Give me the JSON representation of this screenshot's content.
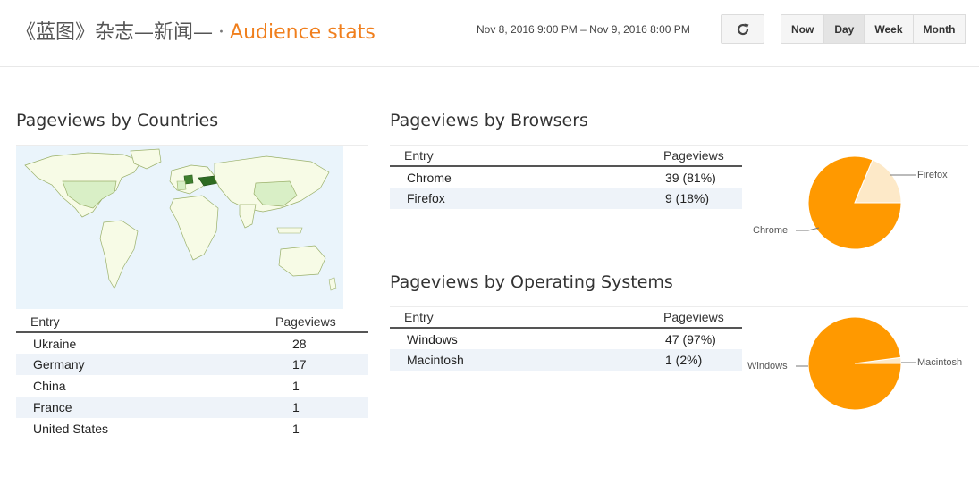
{
  "header": {
    "site_title": "《蓝图》杂志—新闻—",
    "separator": "·",
    "section_title": "Audience stats",
    "date_range": "Nov 8, 2016 9:00 PM – Nov 9, 2016 8:00 PM",
    "refresh_icon": "refresh-icon",
    "period_buttons": [
      {
        "label": "Now",
        "active": false
      },
      {
        "label": "Day",
        "active": true
      },
      {
        "label": "Week",
        "active": false
      },
      {
        "label": "Month",
        "active": false
      }
    ]
  },
  "countries": {
    "title": "Pageviews by Countries",
    "columns": [
      "Entry",
      "Pageviews"
    ],
    "rows": [
      {
        "entry": "Ukraine",
        "value": "28"
      },
      {
        "entry": "Germany",
        "value": "17"
      },
      {
        "entry": "China",
        "value": "1"
      },
      {
        "entry": "France",
        "value": "1"
      },
      {
        "entry": "United States",
        "value": "1"
      }
    ]
  },
  "browsers": {
    "title": "Pageviews by Browsers",
    "columns": [
      "Entry",
      "Pageviews"
    ],
    "rows": [
      {
        "entry": "Chrome",
        "value": "39 (81%)"
      },
      {
        "entry": "Firefox",
        "value": "9 (18%)"
      }
    ]
  },
  "os": {
    "title": "Pageviews by Operating Systems",
    "columns": [
      "Entry",
      "Pageviews"
    ],
    "rows": [
      {
        "entry": "Windows",
        "value": "47 (97%)"
      },
      {
        "entry": "Macintosh",
        "value": "1 (2%)"
      }
    ]
  },
  "colors": {
    "accent": "#f07f1d",
    "pie_primary": "#ff9900",
    "pie_secondary": "#fde9c8",
    "map_ocean": "#eaf4fb",
    "map_land": "#f7fbe6",
    "map_visited": "#d9efc6",
    "map_top": "#3f7f2e"
  },
  "chart_data": [
    {
      "type": "pie",
      "categories": [
        "Chrome",
        "Firefox"
      ],
      "values": [
        39,
        9
      ]
    },
    {
      "type": "pie",
      "categories": [
        "Windows",
        "Macintosh"
      ],
      "values": [
        47,
        1
      ]
    }
  ]
}
